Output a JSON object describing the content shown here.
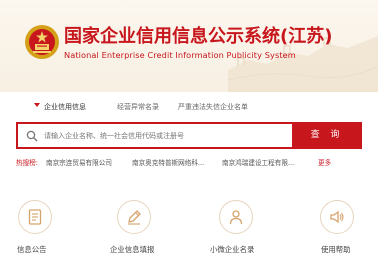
{
  "header": {
    "title": "国家企业信用信息公示系统(江苏)",
    "subtitle": "National Enterprise Credit Information Publicity System"
  },
  "tabs": [
    {
      "label": "企业信用信息",
      "active": true
    },
    {
      "label": "经营异常名录",
      "active": false
    },
    {
      "label": "严重违法失信企业名单",
      "active": false
    }
  ],
  "search": {
    "placeholder": "请输入企业名称、统一社会信用代码或注册号",
    "button_label": "查 询"
  },
  "hot": {
    "label": "热搜榜:",
    "items": [
      "南京宗连贸易有限公司",
      "南京奥克特普斯网络科...",
      "南京鸿瑞建设工程有限..."
    ],
    "more": "更多"
  },
  "tiles": [
    {
      "label": "信息公告",
      "icon": "document-icon"
    },
    {
      "label": "企业信息填报",
      "icon": "pen-icon"
    },
    {
      "label": "小微企业名录",
      "icon": "user-list-icon"
    },
    {
      "label": "使用帮助",
      "icon": "speaker-icon"
    }
  ],
  "colors": {
    "accent": "#c8161d",
    "tile_border": "#e7d4bd",
    "icon": "#d6a36c"
  }
}
